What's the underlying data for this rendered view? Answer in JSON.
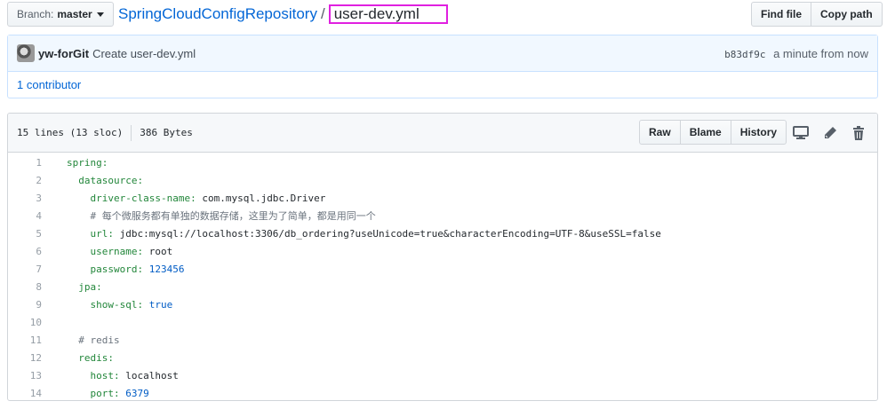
{
  "branch": {
    "label": "Branch:",
    "name": "master"
  },
  "path": {
    "repo": "SpringCloudConfigRepository",
    "separator": "/",
    "file": "user-dev.yml"
  },
  "header_buttons": {
    "find_file": "Find file",
    "copy_path": "Copy path"
  },
  "commit": {
    "author": "yw-forGit",
    "message": "Create user-dev.yml",
    "sha": "b83df9c",
    "time": "a minute from now"
  },
  "contributors": "1 contributor",
  "file_info": {
    "lines": "15 lines (13 sloc)",
    "size": "386 Bytes"
  },
  "file_actions": {
    "raw": "Raw",
    "blame": "Blame",
    "history": "History"
  },
  "icons": {
    "desktop": "desktop-icon",
    "edit": "pencil-icon",
    "delete": "trash-icon"
  },
  "code_lines": [
    {
      "n": "1",
      "indent": "",
      "key": "spring:",
      "value": "",
      "type": "key"
    },
    {
      "n": "2",
      "indent": "  ",
      "key": "datasource:",
      "value": "",
      "type": "key"
    },
    {
      "n": "3",
      "indent": "    ",
      "key": "driver-class-name:",
      "value": " com.mysql.jdbc.Driver",
      "type": "key"
    },
    {
      "n": "4",
      "indent": "    ",
      "key": "",
      "value": "# 每个微服务都有单独的数据存储，这里为了简单，都是用同一个",
      "type": "comment"
    },
    {
      "n": "5",
      "indent": "    ",
      "key": "url:",
      "value": " jdbc:mysql://localhost:3306/db_ordering?useUnicode=true&characterEncoding=UTF-8&useSSL=false",
      "type": "key"
    },
    {
      "n": "6",
      "indent": "    ",
      "key": "username:",
      "value": " root",
      "type": "key"
    },
    {
      "n": "7",
      "indent": "    ",
      "key": "password:",
      "value": " 123456",
      "type": "num"
    },
    {
      "n": "8",
      "indent": "  ",
      "key": "jpa:",
      "value": "",
      "type": "key"
    },
    {
      "n": "9",
      "indent": "    ",
      "key": "show-sql:",
      "value": " true",
      "type": "num"
    },
    {
      "n": "10",
      "indent": "",
      "key": "",
      "value": "",
      "type": "key"
    },
    {
      "n": "11",
      "indent": "  ",
      "key": "",
      "value": "# redis",
      "type": "comment"
    },
    {
      "n": "12",
      "indent": "  ",
      "key": "redis:",
      "value": "",
      "type": "key"
    },
    {
      "n": "13",
      "indent": "    ",
      "key": "host:",
      "value": " localhost",
      "type": "key"
    },
    {
      "n": "14",
      "indent": "    ",
      "key": "port:",
      "value": " 6379",
      "type": "num"
    }
  ],
  "colors": {
    "link": "#0366d6",
    "highlight_border": "#e020e0",
    "yaml_key": "#22863a",
    "yaml_number": "#005cc5"
  }
}
